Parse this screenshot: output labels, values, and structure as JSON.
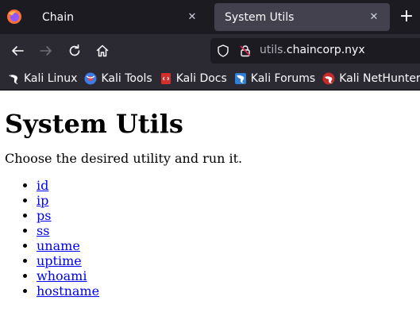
{
  "browser": {
    "tabs": [
      {
        "title": "Chain",
        "active": false
      },
      {
        "title": "System Utils",
        "active": true
      }
    ],
    "close_glyph": "✕",
    "new_tab_glyph": "+",
    "url": {
      "prefix": "utils.",
      "domain": "chaincorp.nyx"
    },
    "bookmarks": [
      {
        "label": "Kali Linux",
        "icon": "kali-dragon-icon"
      },
      {
        "label": "Kali Tools",
        "icon": "kali-tools-icon"
      },
      {
        "label": "Kali Docs",
        "icon": "kali-docs-icon"
      },
      {
        "label": "Kali Forums",
        "icon": "kali-forums-icon"
      },
      {
        "label": "Kali NetHunter",
        "icon": "kali-nethunter-icon"
      }
    ]
  },
  "page": {
    "heading": "System Utils",
    "intro": "Choose the desired utility and run it.",
    "utilities": [
      "id",
      "ip",
      "ps",
      "ss",
      "uname",
      "uptime",
      "whoami",
      "hostname"
    ]
  },
  "colors": {
    "tabbar_bg": "#1c1b22",
    "toolbar_bg": "#2b2a33",
    "active_tab_bg": "#42414d",
    "link": "#0000ee"
  }
}
